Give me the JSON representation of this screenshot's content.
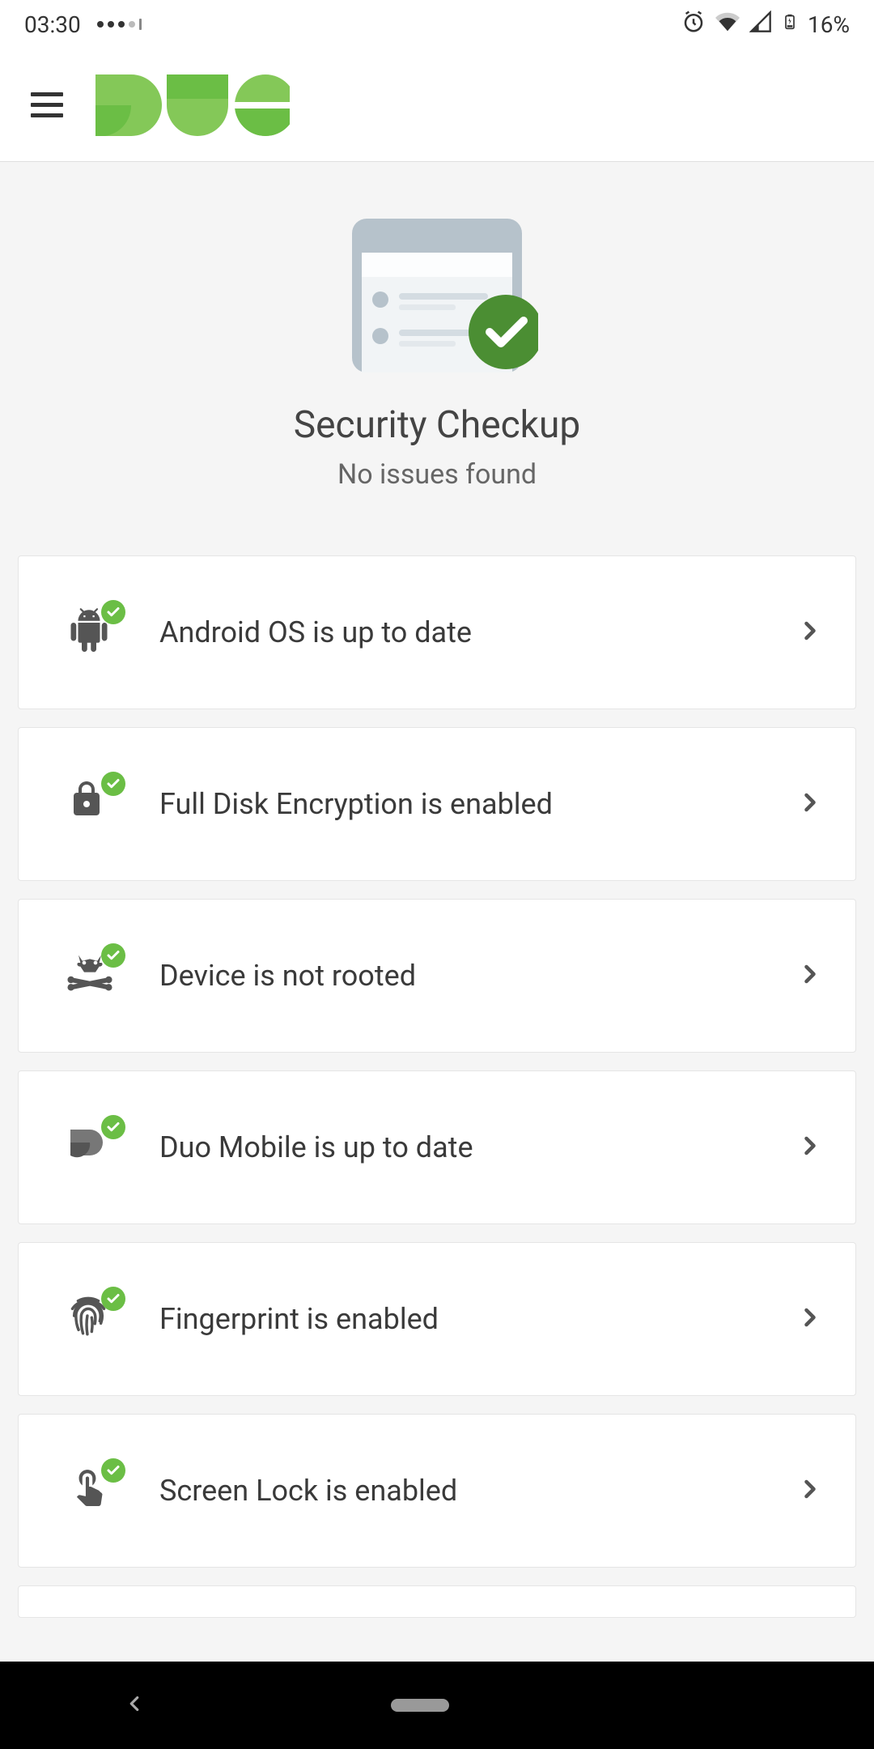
{
  "status": {
    "time": "03:30",
    "battery_text": "16%"
  },
  "header": {
    "title": "Security Checkup",
    "subtitle": "No issues found"
  },
  "checks": [
    {
      "label": "Android OS is up to date",
      "icon": "android-icon",
      "status": "ok"
    },
    {
      "label": "Full Disk Encryption is enabled",
      "icon": "lock-icon",
      "status": "ok"
    },
    {
      "label": "Device is not rooted",
      "icon": "rooted-icon",
      "status": "ok"
    },
    {
      "label": "Duo Mobile is up to date",
      "icon": "duo-shape-icon",
      "status": "ok"
    },
    {
      "label": "Fingerprint is enabled",
      "icon": "fingerprint-icon",
      "status": "ok"
    },
    {
      "label": "Screen Lock is enabled",
      "icon": "touch-icon",
      "status": "ok"
    }
  ],
  "colors": {
    "accent_green": "#6BBE45",
    "accent_green_dark": "#4b8e33"
  }
}
